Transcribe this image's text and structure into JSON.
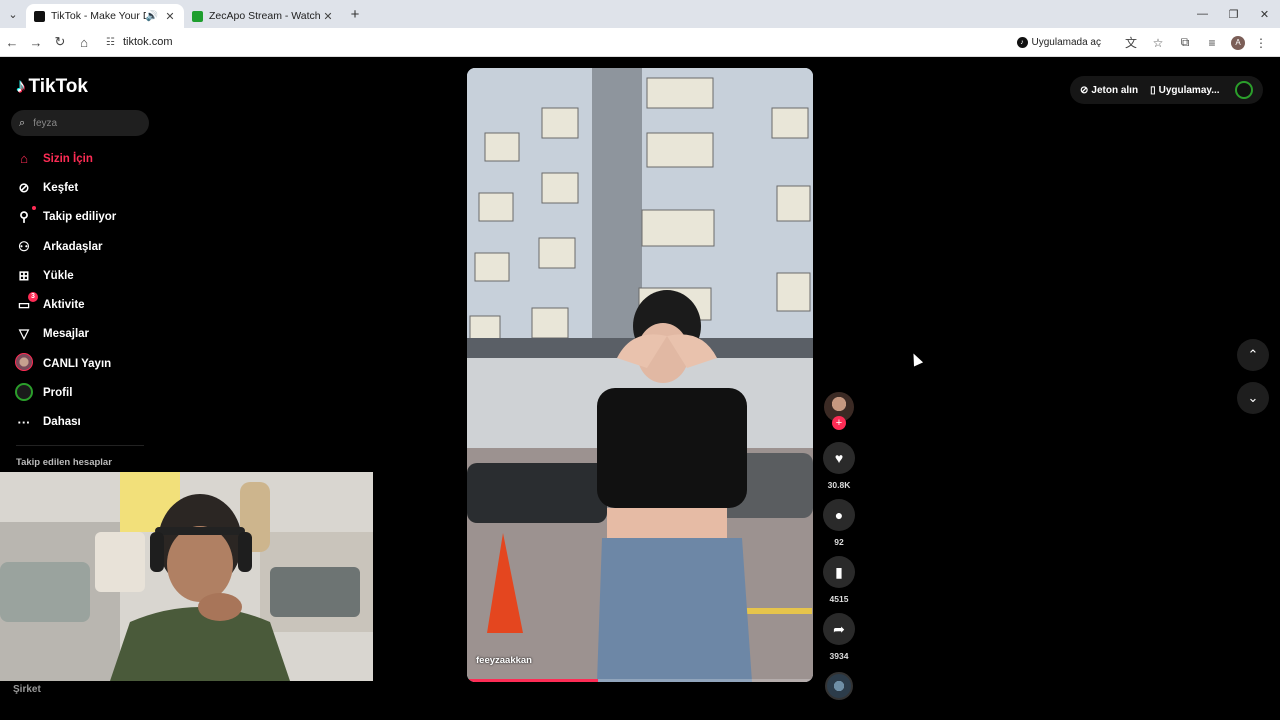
{
  "browser": {
    "tabs": [
      {
        "title": "TikTok - Make Your Day",
        "active": true,
        "favicon_color": "#111111"
      },
      {
        "title": "ZecApo Stream - Watch Live on",
        "active": false,
        "favicon_color": "#1e9e2e"
      }
    ],
    "url": "tiktok.com",
    "open_in_app_label": "Uygulamada aç",
    "profile_initial": "A"
  },
  "tiktok": {
    "logo_text": "TikTok",
    "search_placeholder": "feyza",
    "menu": [
      {
        "label": "Sizin İçin",
        "icon": "home-icon",
        "active": true
      },
      {
        "label": "Keşfet",
        "icon": "compass-icon"
      },
      {
        "label": "Takip ediliyor",
        "icon": "following-icon"
      },
      {
        "label": "Arkadaşlar",
        "icon": "friends-icon"
      },
      {
        "label": "Yükle",
        "icon": "upload-icon"
      },
      {
        "label": "Aktivite",
        "icon": "activity-icon",
        "badge": "3"
      },
      {
        "label": "Mesajlar",
        "icon": "messages-icon"
      },
      {
        "label": "CANLI Yayın",
        "icon": "live-avatar-icon"
      },
      {
        "label": "Profil",
        "icon": "profile-avatar-icon"
      },
      {
        "label": "Dahası",
        "icon": "more-icon"
      }
    ],
    "followed_accounts_heading": "Takip edilen hesaplar",
    "company_label": "Şirket",
    "top_right": {
      "coins_label": "Jeton alın",
      "app_label": "Uygulamay..."
    },
    "video": {
      "author": "feeyzaakkan",
      "progress": 0.38,
      "likes": "30.8K",
      "comments": "92",
      "saves": "4515",
      "shares": "3934"
    },
    "colors": {
      "accent": "#fe2c55",
      "background": "#000000"
    }
  }
}
